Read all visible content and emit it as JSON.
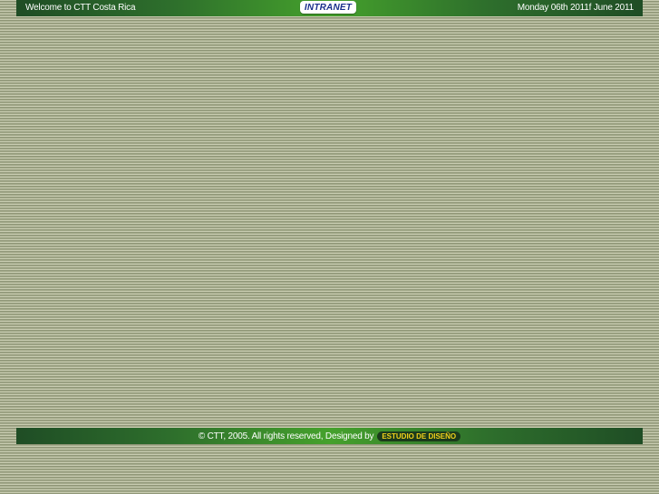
{
  "header": {
    "welcome_text": "Welcome to CTT Costa Rica",
    "intranet_label": "INTRANET",
    "date_text": "Monday 06th 2011f June 2011"
  },
  "footer": {
    "copyright_text": "© CTT, 2005. All rights reserved, Designed by",
    "designer_label": "ESTUDIO DE DISEÑO"
  },
  "colors": {
    "bar_dark_green": "#1f4d25",
    "bar_light_green": "#45a12c",
    "intranet_text": "#1a2f8c",
    "designer_badge_text": "#f2d21a",
    "background_stripes": "#a3a98a"
  }
}
